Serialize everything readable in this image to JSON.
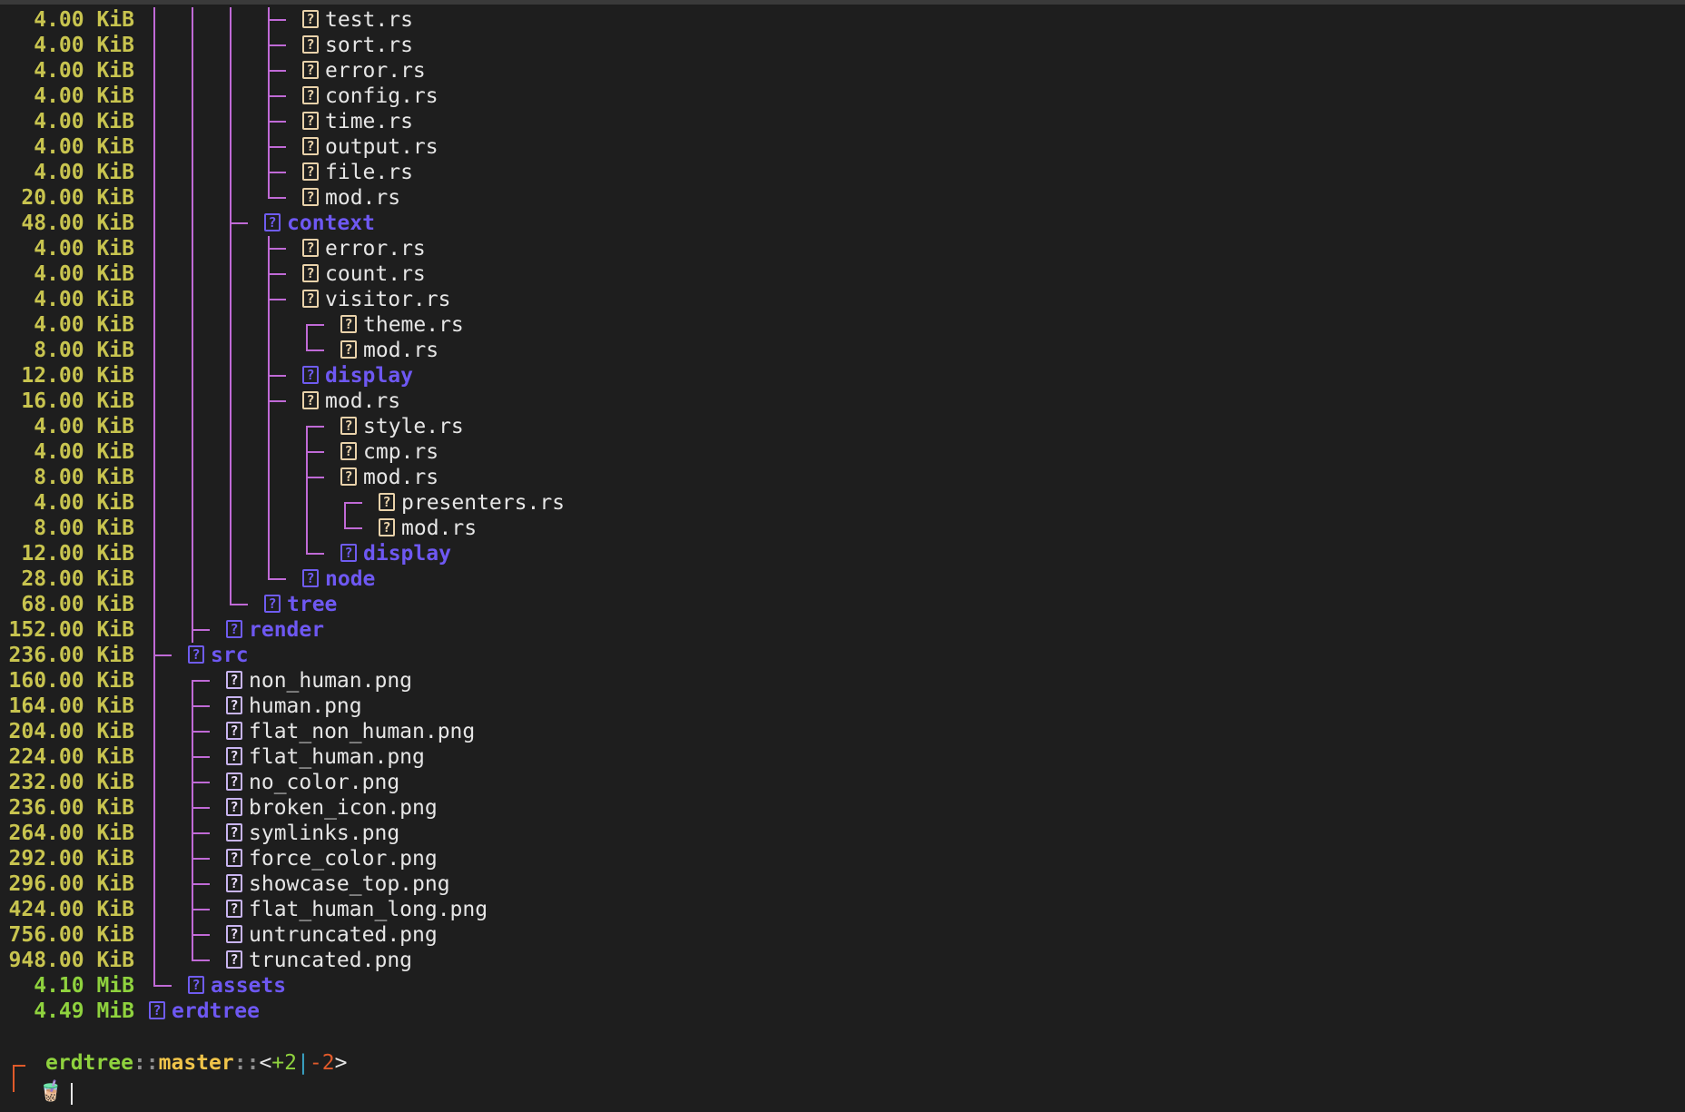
{
  "colors": {
    "background": "#1e1e1e",
    "size_kib": "#c8c44f",
    "size_mib": "#8fd23e",
    "tree_lines": "#c06ad6",
    "dir_name": "#6e58f2",
    "file_name": "#e6e6e6"
  },
  "icons": {
    "file": "question-mark-box-icon",
    "directory": "question-mark-box-icon"
  },
  "tree": [
    {
      "size": "4.00 KiB",
      "name": "test.rs",
      "kind": "file",
      "depth": 3,
      "anc": [
        1,
        1,
        1
      ]
    },
    {
      "size": "4.00 KiB",
      "name": "sort.rs",
      "kind": "file",
      "depth": 3,
      "anc": [
        1,
        1,
        1
      ]
    },
    {
      "size": "4.00 KiB",
      "name": "error.rs",
      "kind": "file",
      "depth": 3,
      "anc": [
        1,
        1,
        1
      ]
    },
    {
      "size": "4.00 KiB",
      "name": "config.rs",
      "kind": "file",
      "depth": 3,
      "anc": [
        1,
        1,
        1
      ]
    },
    {
      "size": "4.00 KiB",
      "name": "time.rs",
      "kind": "file",
      "depth": 3,
      "anc": [
        1,
        1,
        1
      ]
    },
    {
      "size": "4.00 KiB",
      "name": "output.rs",
      "kind": "file",
      "depth": 3,
      "anc": [
        1,
        1,
        1
      ]
    },
    {
      "size": "4.00 KiB",
      "name": "file.rs",
      "kind": "file",
      "depth": 3,
      "anc": [
        1,
        1,
        1
      ]
    },
    {
      "size": "20.00 KiB",
      "name": "mod.rs",
      "kind": "file",
      "depth": 3,
      "anc": [
        1,
        1,
        1
      ],
      "end": 1
    },
    {
      "size": "48.00 KiB",
      "name": "context",
      "kind": "dir",
      "depth": 2,
      "anc": [
        1,
        1
      ]
    },
    {
      "size": "4.00 KiB",
      "name": "error.rs",
      "kind": "file",
      "depth": 3,
      "anc": [
        1,
        1,
        1
      ]
    },
    {
      "size": "4.00 KiB",
      "name": "count.rs",
      "kind": "file",
      "depth": 3,
      "anc": [
        1,
        1,
        1
      ]
    },
    {
      "size": "4.00 KiB",
      "name": "visitor.rs",
      "kind": "file",
      "depth": 3,
      "anc": [
        1,
        1,
        1
      ]
    },
    {
      "size": "4.00 KiB",
      "name": "theme.rs",
      "kind": "file",
      "depth": 4,
      "anc": [
        1,
        1,
        1,
        1
      ],
      "start": 1
    },
    {
      "size": "8.00 KiB",
      "name": "mod.rs",
      "kind": "file",
      "depth": 4,
      "anc": [
        1,
        1,
        1,
        1
      ],
      "end": 1
    },
    {
      "size": "12.00 KiB",
      "name": "display",
      "kind": "dir",
      "depth": 3,
      "anc": [
        1,
        1,
        1
      ]
    },
    {
      "size": "16.00 KiB",
      "name": "mod.rs",
      "kind": "file",
      "depth": 3,
      "anc": [
        1,
        1,
        1
      ]
    },
    {
      "size": "4.00 KiB",
      "name": "style.rs",
      "kind": "file",
      "depth": 4,
      "anc": [
        1,
        1,
        1,
        1
      ],
      "start": 1
    },
    {
      "size": "4.00 KiB",
      "name": "cmp.rs",
      "kind": "file",
      "depth": 4,
      "anc": [
        1,
        1,
        1,
        1
      ]
    },
    {
      "size": "8.00 KiB",
      "name": "mod.rs",
      "kind": "file",
      "depth": 4,
      "anc": [
        1,
        1,
        1,
        1
      ]
    },
    {
      "size": "4.00 KiB",
      "name": "presenters.rs",
      "kind": "file",
      "depth": 5,
      "anc": [
        1,
        1,
        1,
        1,
        1
      ],
      "start": 1
    },
    {
      "size": "8.00 KiB",
      "name": "mod.rs",
      "kind": "file",
      "depth": 5,
      "anc": [
        1,
        1,
        1,
        1,
        1
      ],
      "end": 1
    },
    {
      "size": "12.00 KiB",
      "name": "display",
      "kind": "dir",
      "depth": 4,
      "anc": [
        1,
        1,
        1,
        1
      ],
      "end": 1
    },
    {
      "size": "28.00 KiB",
      "name": "node",
      "kind": "dir",
      "depth": 3,
      "anc": [
        1,
        1,
        1
      ],
      "end": 1
    },
    {
      "size": "68.00 KiB",
      "name": "tree",
      "kind": "dir",
      "depth": 2,
      "anc": [
        1,
        1
      ],
      "end": 1
    },
    {
      "size": "152.00 KiB",
      "name": "render",
      "kind": "dir",
      "depth": 1,
      "anc": [
        1
      ]
    },
    {
      "size": "236.00 KiB",
      "name": "src",
      "kind": "dir",
      "depth": 0,
      "anc": []
    },
    {
      "size": "160.00 KiB",
      "name": "non_human.png",
      "kind": "img",
      "depth": 1,
      "anc": [
        1
      ],
      "start": 1
    },
    {
      "size": "164.00 KiB",
      "name": "human.png",
      "kind": "img",
      "depth": 1,
      "anc": [
        1
      ]
    },
    {
      "size": "204.00 KiB",
      "name": "flat_non_human.png",
      "kind": "img",
      "depth": 1,
      "anc": [
        1
      ]
    },
    {
      "size": "224.00 KiB",
      "name": "flat_human.png",
      "kind": "img",
      "depth": 1,
      "anc": [
        1
      ]
    },
    {
      "size": "232.00 KiB",
      "name": "no_color.png",
      "kind": "img",
      "depth": 1,
      "anc": [
        1
      ]
    },
    {
      "size": "236.00 KiB",
      "name": "broken_icon.png",
      "kind": "img",
      "depth": 1,
      "anc": [
        1
      ]
    },
    {
      "size": "264.00 KiB",
      "name": "symlinks.png",
      "kind": "img",
      "depth": 1,
      "anc": [
        1
      ]
    },
    {
      "size": "292.00 KiB",
      "name": "force_color.png",
      "kind": "img",
      "depth": 1,
      "anc": [
        1
      ]
    },
    {
      "size": "296.00 KiB",
      "name": "showcase_top.png",
      "kind": "img",
      "depth": 1,
      "anc": [
        1
      ]
    },
    {
      "size": "424.00 KiB",
      "name": "flat_human_long.png",
      "kind": "img",
      "depth": 1,
      "anc": [
        1
      ]
    },
    {
      "size": "756.00 KiB",
      "name": "untruncated.png",
      "kind": "img",
      "depth": 1,
      "anc": [
        1
      ]
    },
    {
      "size": "948.00 KiB",
      "name": "truncated.png",
      "kind": "img",
      "depth": 1,
      "anc": [
        1
      ],
      "end": 1
    },
    {
      "size": "4.10 MiB",
      "name": "assets",
      "kind": "dir",
      "depth": 0,
      "anc": [],
      "end": 1
    },
    {
      "size": "4.49 MiB",
      "name": "erdtree",
      "kind": "dir",
      "depth": -1,
      "anc": []
    }
  ],
  "prompt": {
    "repo": "erdtree",
    "sep1": "::",
    "branch": "master",
    "sep2": "::",
    "open": "<",
    "added": "+2",
    "bar": "|",
    "removed": "-2",
    "close": ">",
    "cup": "🧋"
  }
}
